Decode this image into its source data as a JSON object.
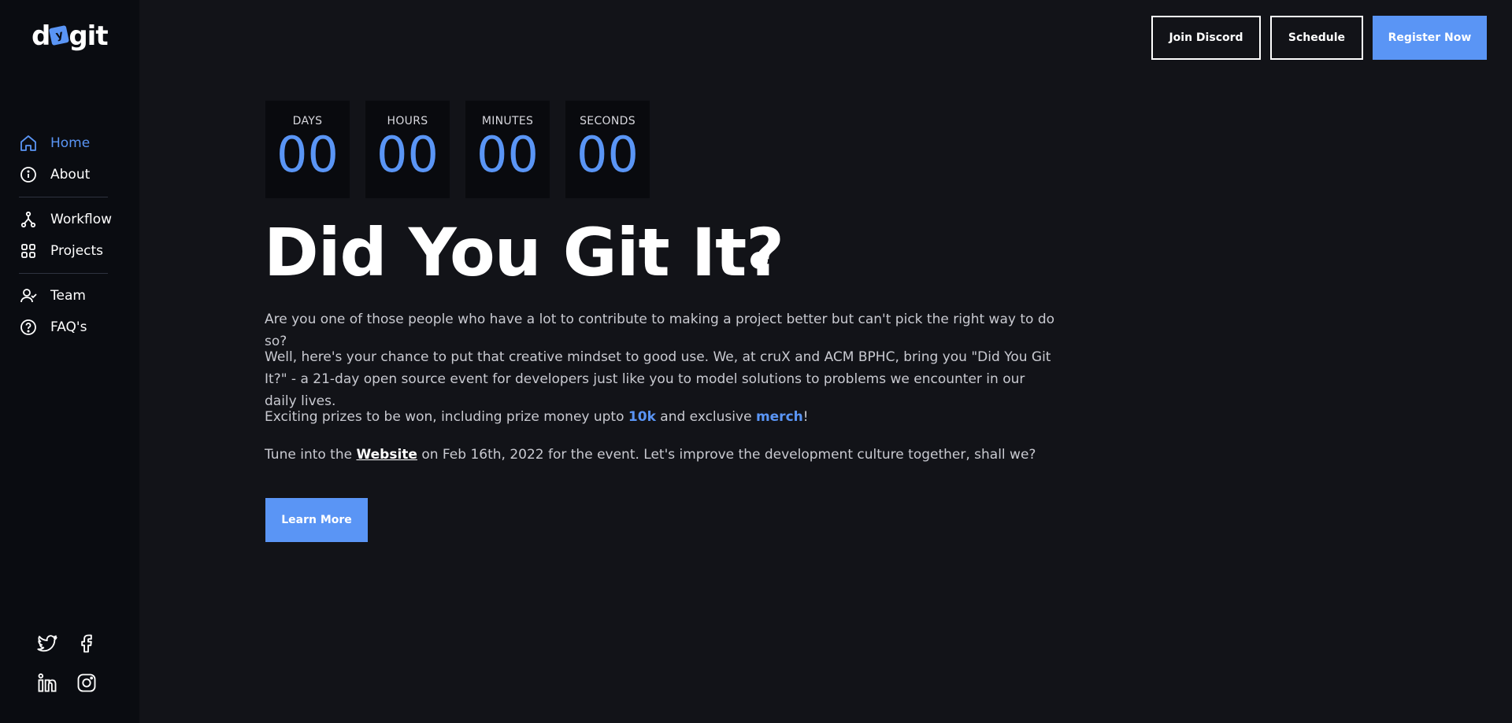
{
  "brand": {
    "logo_left": "d",
    "logo_badge": "y",
    "logo_right": "git"
  },
  "sidebar": {
    "items": [
      {
        "label": "Home",
        "icon": "home-icon",
        "active": true
      },
      {
        "label": "About",
        "icon": "info-icon"
      },
      {
        "label": "Workflow",
        "icon": "workflow-icon"
      },
      {
        "label": "Projects",
        "icon": "grid-icon"
      },
      {
        "label": "Team",
        "icon": "team-icon"
      },
      {
        "label": "FAQ's",
        "icon": "help-icon"
      }
    ],
    "socials": [
      "twitter-icon",
      "facebook-icon",
      "linkedin-icon",
      "instagram-icon"
    ]
  },
  "header": {
    "join_discord": "Join Discord",
    "schedule": "Schedule",
    "register": "Register Now"
  },
  "countdown": [
    {
      "label": "DAYS",
      "value": "00"
    },
    {
      "label": "HOURS",
      "value": "00"
    },
    {
      "label": "MINUTES",
      "value": "00"
    },
    {
      "label": "SECONDS",
      "value": "00"
    }
  ],
  "hero": {
    "title": "Did You Git It?",
    "p1": "Are you one of those people who have a lot to contribute to making a project better but can't pick the right way to do so?",
    "p2": "Well, here's your chance to put that creative mindset to good use. We, at cruX and ACM BPHC, bring you \"Did You Git It?\" - a 21-day open source event for developers just like you to model solutions to problems we encounter in our daily lives.",
    "p3_before": "Exciting prizes to be won, including prize money upto ",
    "p3_hl1": "10k",
    "p3_mid": " and exclusive ",
    "p3_hl2": "merch",
    "p3_after": "!",
    "p4_before": "Tune into the ",
    "p4_link": "Website",
    "p4_after": " on Feb 16th, 2022 for the event. Let's improve the development culture together, shall we?",
    "learn_more": "Learn More"
  },
  "colors": {
    "accent": "#5a95f5",
    "background": "#121318",
    "sidebar": "#0a0c11"
  }
}
